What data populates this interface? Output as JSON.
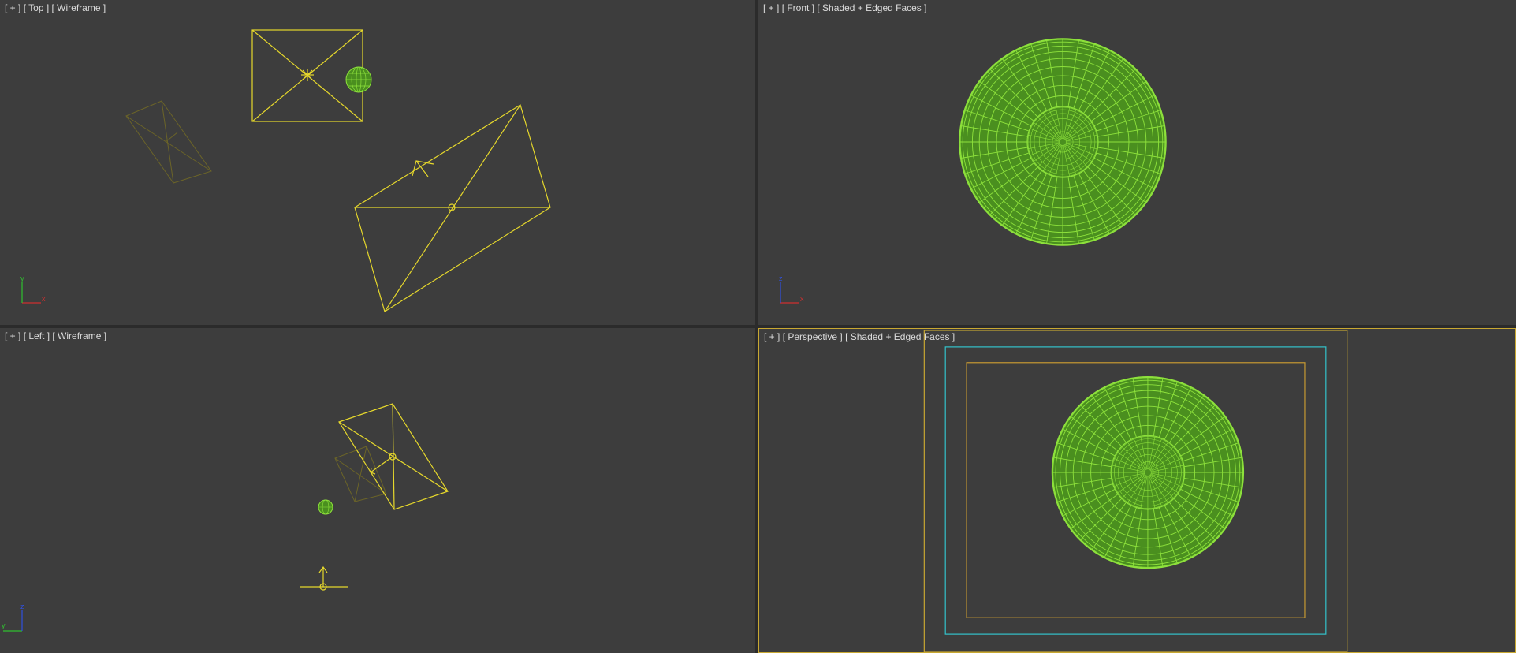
{
  "viewports": {
    "top": {
      "menu": "[ + ]",
      "view": "[ Top ]",
      "shading": "[ Wireframe ]",
      "axis_x": "x",
      "axis_y": "y"
    },
    "front": {
      "menu": "[ + ]",
      "view": "[ Front ]",
      "shading": "[ Shaded + Edged Faces ]",
      "axis_x": "x",
      "axis_y": "z"
    },
    "left": {
      "menu": "[ + ]",
      "view": "[ Left ]",
      "shading": "[ Wireframe ]",
      "axis_x": "y",
      "axis_y": "z"
    },
    "perspective": {
      "menu": "[ + ]",
      "view": "[ Perspective ]",
      "shading": "[ Shaded + Edged Faces ]"
    }
  },
  "colors": {
    "viewport_bg": "#3d3d3d",
    "selected_wire": "#e6d82c",
    "dim_wire": "#6b6428",
    "sphere_fill": "#4a8f1f",
    "sphere_wire": "#8ee23c",
    "safe_frame_outer": "#c8a832",
    "safe_frame_action": "#33c4cc",
    "safe_frame_title": "#c89a32",
    "axis_x": "#d03030",
    "axis_y": "#30c030",
    "axis_z": "#3050e0"
  }
}
